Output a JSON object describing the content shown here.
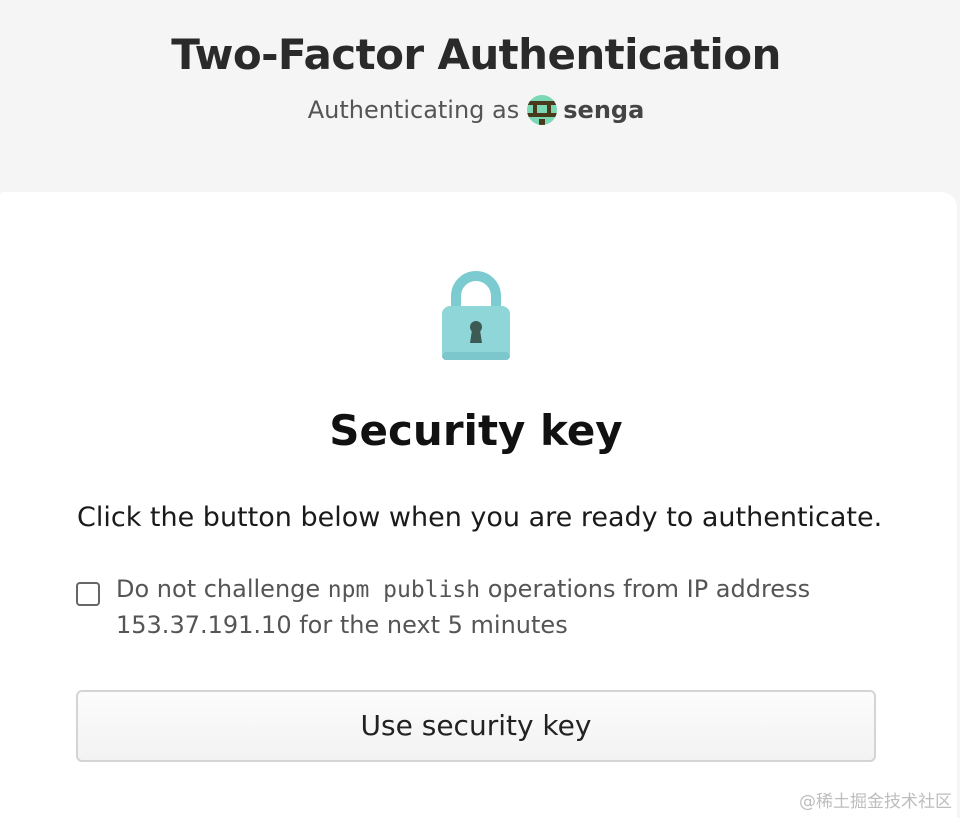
{
  "header": {
    "title": "Two-Factor Authentication",
    "subtitle_prefix": "Authenticating as",
    "username": "senga",
    "avatar_colors": [
      "#7bd8b5",
      "#4a3a1c"
    ]
  },
  "card": {
    "icon": "lock-icon",
    "title": "Security key",
    "instruction": "Click the button below when you are ready to authenticate.",
    "checkbox": {
      "checked": false,
      "text_before": "Do not challenge",
      "command": "npm publish",
      "text_after": "operations from IP address 153.37.191.10 for the next 5 minutes"
    },
    "button_label": "Use security key"
  },
  "colors": {
    "lock_body": "#8fd6d8",
    "lock_shackle": "#7ccbd0",
    "keyhole": "#3d5a55",
    "page_bg": "#f5f5f5",
    "card_bg": "#ffffff"
  },
  "watermark": "@稀土掘金技术社区"
}
